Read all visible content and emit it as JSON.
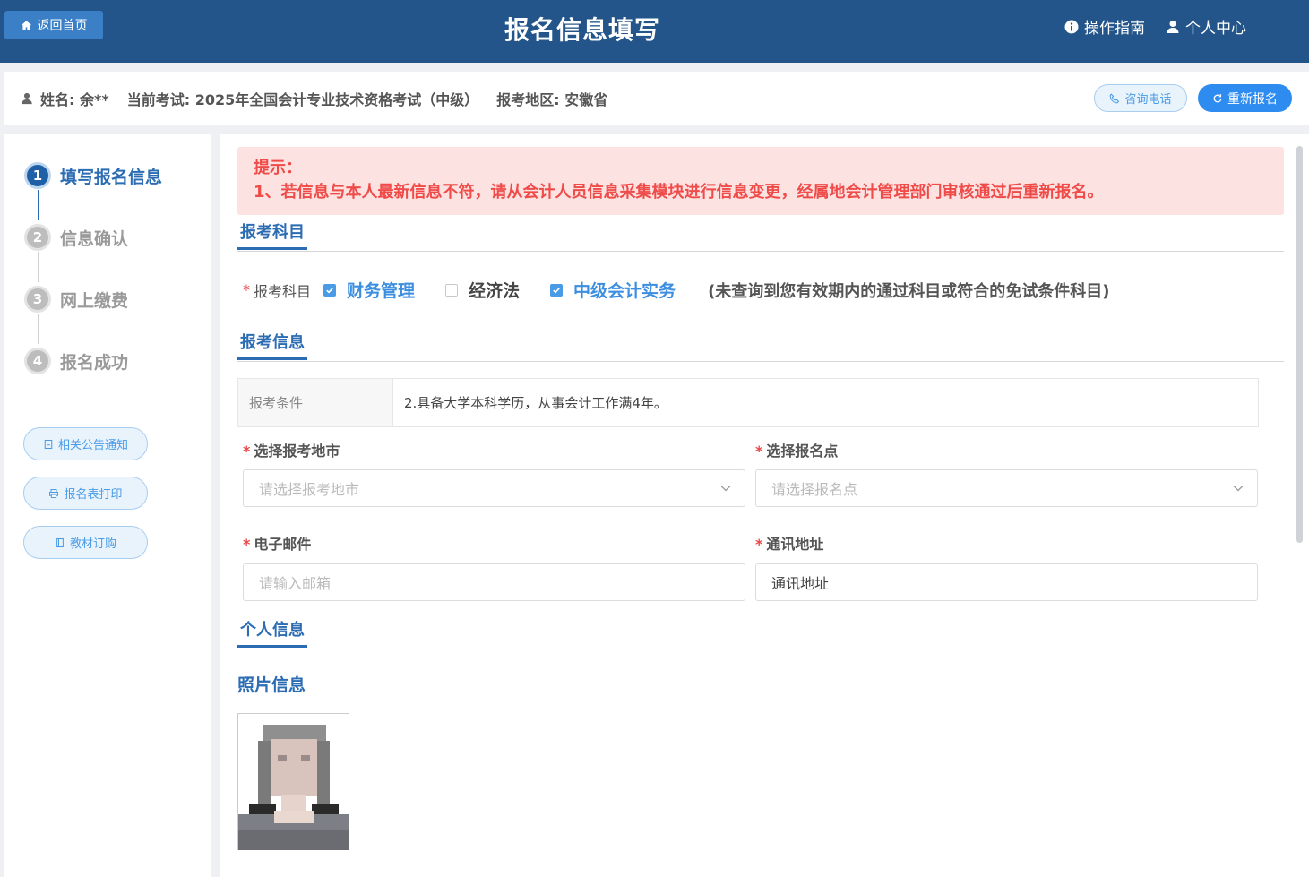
{
  "header": {
    "home_label": "返回首页",
    "title": "报名信息填写",
    "guide_label": "操作指南",
    "profile_label": "个人中心"
  },
  "infobar": {
    "name_text": "姓名: 余**",
    "exam_text": "当前考试: 2025年全国会计专业技术资格考试（中级）",
    "region_text": "报考地区: 安徽省",
    "phone_label": "咨询电话",
    "reapply_label": "重新报名"
  },
  "steps": [
    {
      "num": "1",
      "label": "填写报名信息",
      "active": true
    },
    {
      "num": "2",
      "label": "信息确认",
      "active": false
    },
    {
      "num": "3",
      "label": "网上缴费",
      "active": false
    },
    {
      "num": "4",
      "label": "报名成功",
      "active": false
    }
  ],
  "side_buttons": {
    "notice": "相关公告通知",
    "print": "报名表打印",
    "books": "教材订购"
  },
  "notice": {
    "title": "提示：",
    "line1": "1、若信息与本人最新信息不符，请从会计人员信息采集模块进行信息变更，经属地会计管理部门审核通过后重新报名。"
  },
  "sections": {
    "subjects": "报考科目",
    "exam_info": "报考信息",
    "personal": "个人信息",
    "photo": "照片信息"
  },
  "subjects": {
    "label": "报考科目",
    "items": [
      {
        "name": "财务管理",
        "checked": true
      },
      {
        "name": "经济法",
        "checked": false
      },
      {
        "name": "中级会计实务",
        "checked": true
      }
    ],
    "note": "(未查询到您有效期内的通过科目或符合的免试条件科目)"
  },
  "condition": {
    "key": "报考条件",
    "value": "2.具备大学本科学历，从事会计工作满4年。"
  },
  "form": {
    "city_label": "选择报考地市",
    "city_placeholder": "请选择报考地市",
    "point_label": "选择报名点",
    "point_placeholder": "请选择报名点",
    "email_label": "电子邮件",
    "email_placeholder": "请输入邮箱",
    "address_label": "通讯地址",
    "address_value": "通讯地址",
    "required_mark": "*"
  },
  "colors": {
    "header_bg": "#23558a",
    "accent": "#2b6cb3",
    "notice_text": "#ef4b48",
    "notice_bg": "#fde2e2"
  }
}
